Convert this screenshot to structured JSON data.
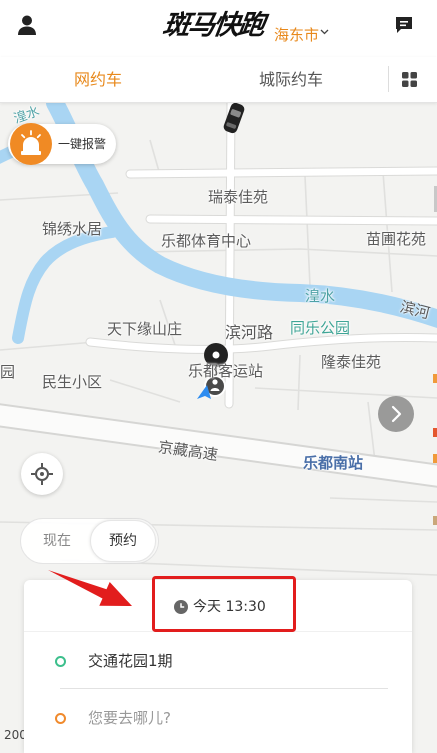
{
  "header": {
    "logo_text": "斑马快跑",
    "city": "海东市"
  },
  "tabs": {
    "active_index": 0,
    "items": [
      {
        "label": "网约车"
      },
      {
        "label": "城际约车"
      }
    ]
  },
  "alarm": {
    "label": "一键报警"
  },
  "map": {
    "labels": [
      "湟水",
      "瑞泰佳苑",
      "锦绣水居",
      "乐都体育中心",
      "苗圃花苑",
      "湟水",
      "滨河",
      "天下缘山庄",
      "滨河路",
      "同乐公园",
      "园",
      "民生小区",
      "乐都客运站",
      "隆泰佳苑",
      "京藏高速",
      "乐都南站"
    ],
    "scale": "200"
  },
  "time_toggle": {
    "selected_index": 1,
    "options": [
      "现在",
      "预约"
    ]
  },
  "trip": {
    "time": "今天 13:30",
    "origin": "交通花园1期",
    "destination_placeholder": "您要去哪儿?"
  },
  "icons": {
    "profile": "user-icon",
    "messages": "message-icon",
    "city_dropdown": "chevron-down-icon",
    "more_services": "grid-icon",
    "alarm": "siren-icon",
    "driver_car": "car-icon",
    "pickup_pin": "pin-icon",
    "my_location": "location-arrow-icon",
    "map_next": "chevron-right-icon",
    "locate": "crosshair-icon",
    "time": "clock-icon",
    "origin": "origin-dot-icon",
    "destination": "destination-dot-icon"
  },
  "colors": {
    "accent": "#e8891c",
    "origin_dot": "#3cbf8c",
    "destination_dot": "#f08a2c",
    "alarm": "#f08a24",
    "annotation": "#e21d1d",
    "river": "#a9d5f3"
  }
}
